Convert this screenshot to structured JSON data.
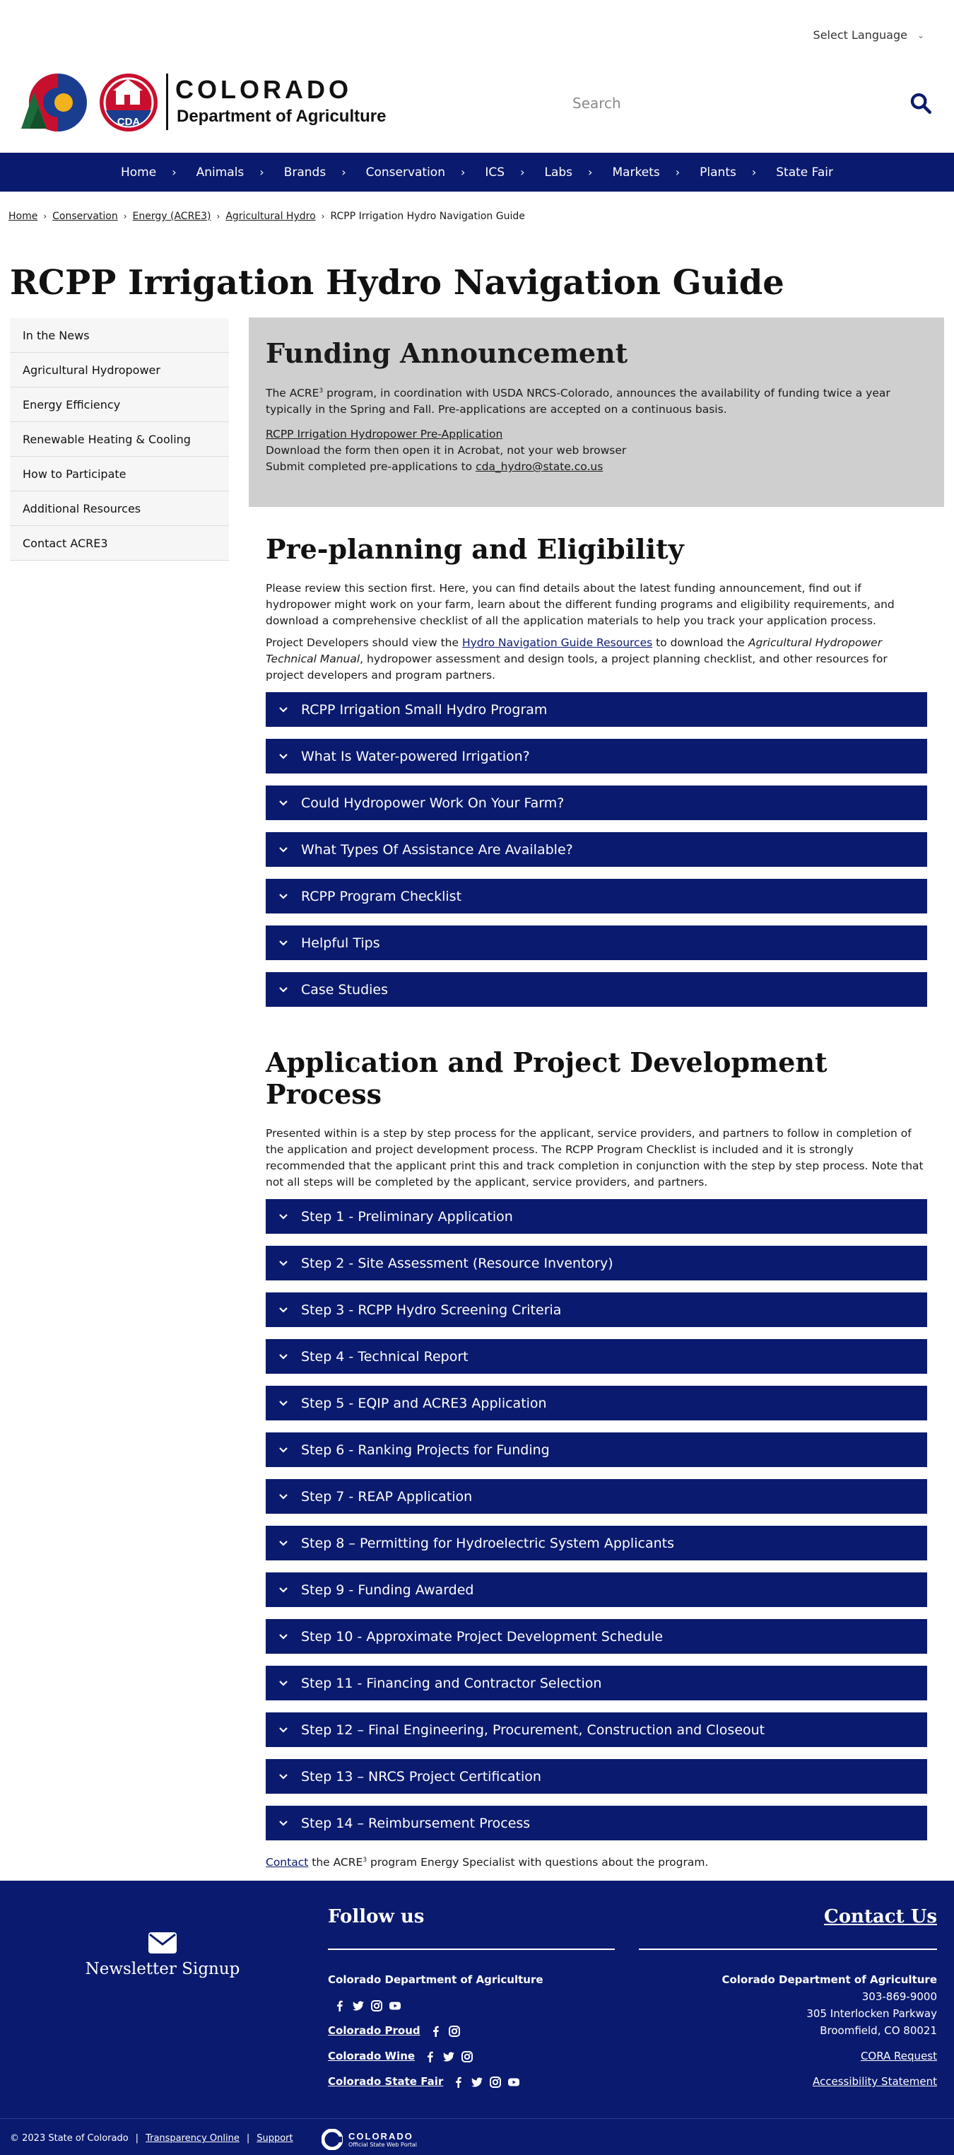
{
  "header": {
    "language": "Select Language",
    "logo_title": "COLORADO",
    "logo_subtitle": "Department of Agriculture",
    "search_placeholder": "Search"
  },
  "nav": [
    "Home",
    "Animals",
    "Brands",
    "Conservation",
    "ICS",
    "Labs",
    "Markets",
    "Plants",
    "State Fair"
  ],
  "breadcrumb": [
    "Home",
    "Conservation",
    "Energy (ACRE3)",
    "Agricultural Hydro",
    "RCPP Irrigation Hydro Navigation Guide"
  ],
  "page_title": "RCPP Irrigation Hydro Navigation Guide",
  "sidebar": [
    "In the News",
    "Agricultural Hydropower",
    "Energy Efficiency",
    "Renewable Heating & Cooling",
    "How to Participate",
    "Additional Resources",
    "Contact ACRE3"
  ],
  "funding": {
    "title": "Funding Announcement",
    "text_a": "The ACRE",
    "sup": "3",
    "text_b": " program, in coordination with USDA NRCS-Colorado, announces the availability of funding twice a year typically in the Spring and Fall. Pre-applications are accepted on a continuous basis.",
    "link": "RCPP Irrigation Hydropower Pre-Application",
    "line2": "Download the form then open it in Acrobat, not your web browser",
    "line3": "Submit completed pre-applications to ",
    "email": "cda_hydro@state.co.us"
  },
  "preplanning": {
    "title": "Pre-planning and Eligibility",
    "p1": "Please review this section first. Here, you can find details about the latest funding announcement, find out if hydropower might work on your farm, learn about the different funding programs and eligibility requirements, and download a comprehensive checklist of all the application materials to help you track your application process.",
    "p2_a": "Project Developers should view the ",
    "p2_link": "Hydro Navigation Guide Resources",
    "p2_b": " to download the ",
    "p2_em": "Agricultural Hydropower Technical Manual",
    "p2_c": ", hydropower assessment and design tools, a project planning checklist, and other resources for project developers and program partners.",
    "items": [
      "RCPP Irrigation Small Hydro Program",
      "What Is Water-powered Irrigation?",
      "Could Hydropower Work On Your Farm?",
      "What Types Of Assistance Are Available?",
      "RCPP Program Checklist",
      "Helpful Tips",
      "Case Studies"
    ]
  },
  "application": {
    "title": "Application and Project Development Process",
    "p1": "Presented within is a step by step process for the applicant, service providers, and partners to follow in completion of the application and project development process.  The RCPP Program Checklist is included and it is strongly recommended that the applicant print this and track completion in conjunction with the step by step process.  Note that not all steps will be completed by the applicant, service providers, and partners.",
    "items": [
      "Step 1 - Preliminary Application",
      "Step 2 - Site Assessment (Resource Inventory)",
      "Step 3 - RCPP Hydro Screening Criteria",
      "Step 4 - Technical Report",
      "Step 5 - EQIP and ACRE3 Application",
      "Step 6 - Ranking Projects for Funding",
      "Step 7 - REAP Application",
      "Step 8 – Permitting for Hydroelectric System Applicants",
      "Step 9 - Funding Awarded",
      "Step 10 - Approximate Project Development Schedule",
      "Step 11 - Financing and Contractor Selection",
      "Step 12 – Final Engineering, Procurement, Construction and Closeout",
      "Step 13 – NRCS Project Certification",
      "Step 14 – Reimbursement Process"
    ],
    "contact_link": "Contact",
    "contact_a": " the ACRE",
    "contact_sup": "3",
    "contact_b": " program Energy Specialist with questions about the program."
  },
  "footer": {
    "newsletter": "Newsletter Signup",
    "follow": "Follow us",
    "accounts": [
      "Colorado Department of Agriculture",
      "Colorado Proud",
      "Colorado Wine",
      "Colorado State Fair"
    ],
    "contact_title": "Contact Us",
    "address": [
      "Colorado Department of Agriculture",
      "303-869-9000",
      "305 Interlocken Parkway",
      "Broomfield, CO 80021"
    ],
    "links": [
      "CORA Request",
      "Accessibility Statement"
    ],
    "copyright": "© 2023 State of Colorado",
    "bottom_links": [
      "Transparency Online",
      "Support"
    ],
    "portal_title": "COLORADO",
    "portal_subtitle": "Official State Web Portal"
  },
  "colors": {
    "brand": "#0a1a6e",
    "announcement_bg": "#cfcfcf"
  }
}
